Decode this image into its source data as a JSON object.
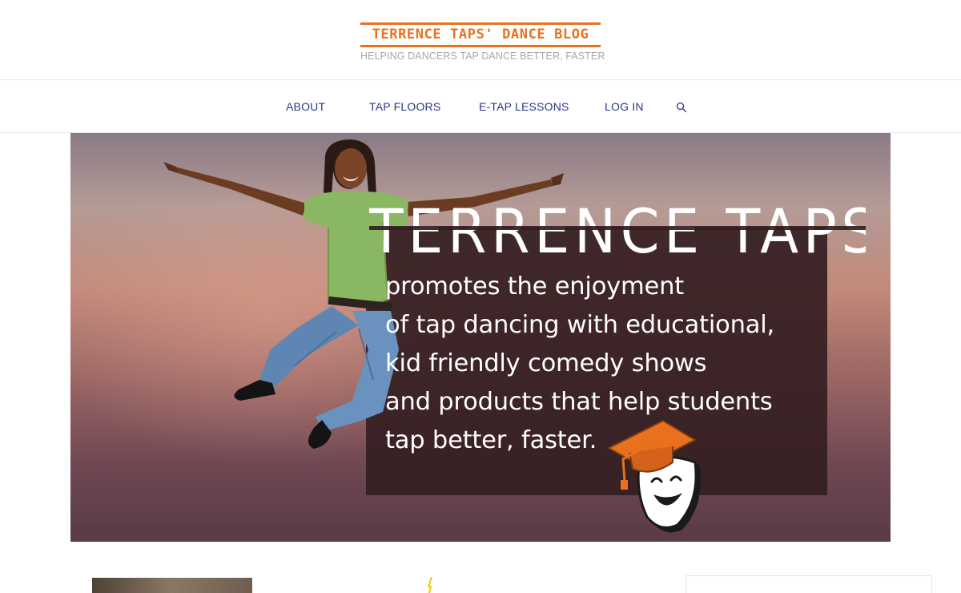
{
  "site": {
    "title": "TERRENCE TAPS' DANCE BLOG",
    "tagline": "HELPING DANCERS TAP DANCE BETTER, FASTER",
    "brand_color": "#e8701f",
    "tagline_color": "#a8a8a8"
  },
  "nav": {
    "link_color": "#2c3585",
    "items": [
      {
        "label": "ABOUT"
      },
      {
        "label": "TAP FLOORS"
      },
      {
        "label": "E-TAP LESSONS"
      },
      {
        "label": "LOG IN"
      }
    ],
    "search_icon": "search-icon"
  },
  "hero": {
    "headline": "TERRENCE TAPS",
    "lines": [
      "promotes the enjoyment",
      "of tap dancing  with educational,",
      "kid friendly comedy shows",
      "and products that help students",
      "tap better, faster."
    ],
    "panel_color": "#341e22",
    "images": {
      "dancer": "jumping-tap-dancer",
      "mascot": "graduation-cap-comedy-mask-mascot"
    }
  },
  "content": {
    "post_thumbnail": "post-thumbnail-image",
    "sidebar_widget": "sidebar-widget-box"
  }
}
